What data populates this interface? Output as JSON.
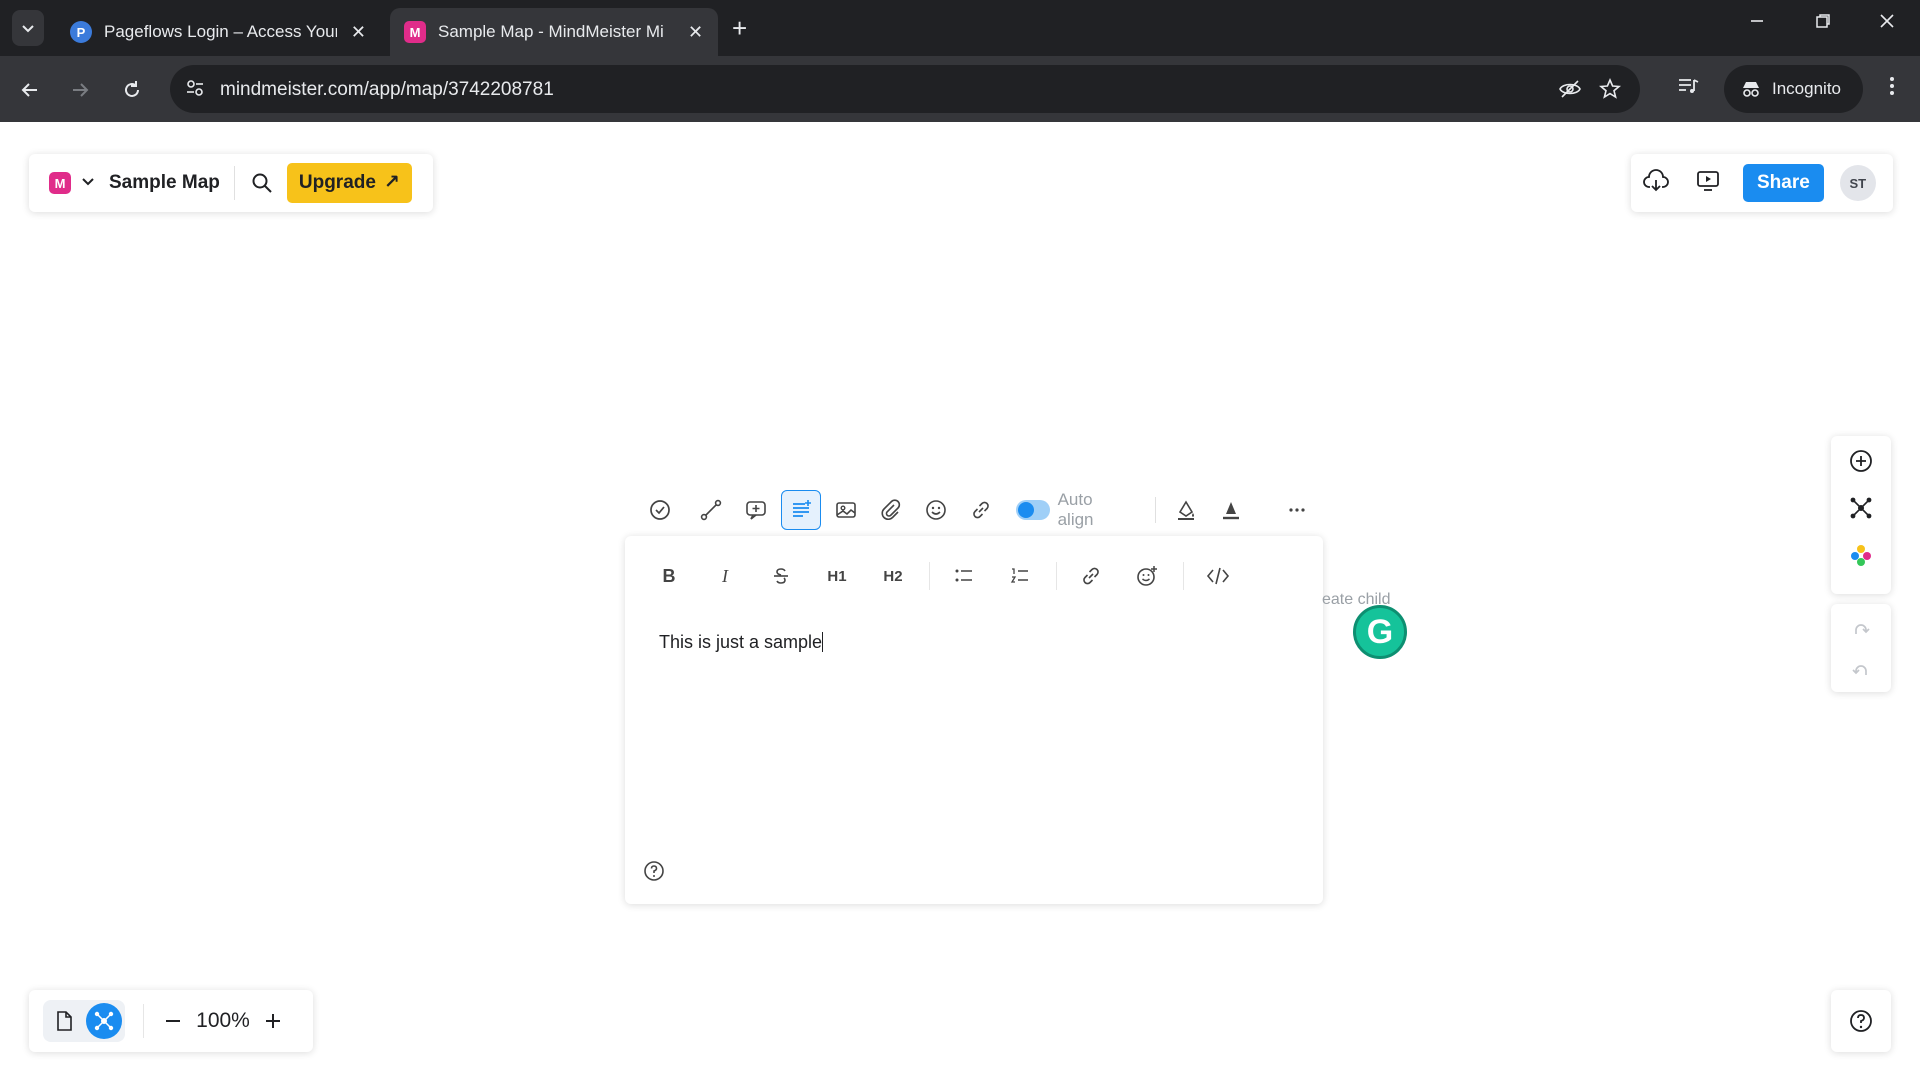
{
  "browser": {
    "tabs": [
      {
        "title": "Pageflows Login – Access Your I",
        "favicon_letter": "P",
        "active": false
      },
      {
        "title": "Sample Map - MindMeister Mi",
        "favicon_letter": "M",
        "active": true
      }
    ],
    "url": "mindmeister.com/app/map/3742208781",
    "incognito_label": "Incognito",
    "window_controls": [
      "minimize-icon",
      "restore-icon",
      "close-icon"
    ]
  },
  "header": {
    "logo_letter": "M",
    "map_title": "Sample Map",
    "upgrade_label": "Upgrade",
    "upgrade_arrow": "↗"
  },
  "top_actions": {
    "share_label": "Share",
    "avatar_initials": "ST",
    "icons": [
      "cloud-download-icon",
      "presentation-icon"
    ]
  },
  "topic_toolbar": {
    "buttons": [
      "task-icon",
      "connection-icon",
      "comment-icon",
      "notes-icon",
      "image-icon",
      "attachment-icon",
      "emoji-icon",
      "link-icon"
    ],
    "active_button": "notes-icon",
    "auto_align_label": "Auto align",
    "auto_align_on": true,
    "style_icons": [
      "fill-color-icon",
      "text-color-icon",
      "more-icon"
    ]
  },
  "notes_editor": {
    "format_buttons": {
      "bold": "B",
      "italic": "I",
      "h1": "H1",
      "h2": "H2"
    },
    "text": "This is just a sample"
  },
  "canvas": {
    "create_child_hint": "eate child",
    "grammarly_letter": "G"
  },
  "zoom": {
    "value": "100%",
    "minus": "−",
    "plus": "+"
  },
  "colors": {
    "accent": "#1a8cf0",
    "upgrade": "#f7c21a",
    "brand": "#e02c8a",
    "grammarly": "#15c39a"
  }
}
